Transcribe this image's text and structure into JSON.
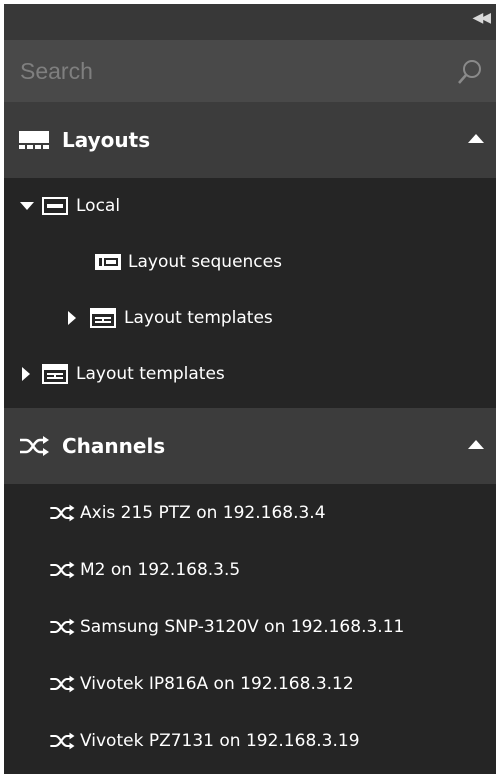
{
  "search": {
    "placeholder": "Search"
  },
  "layouts": {
    "title": "Layouts",
    "tree": {
      "local": "Local",
      "layout_sequences": "Layout sequences",
      "layout_templates_nested": "Layout templates",
      "layout_templates": "Layout templates"
    }
  },
  "channels": {
    "title": "Channels",
    "items": [
      "Axis 215 PTZ on 192.168.3.4",
      "M2 on 192.168.3.5",
      "Samsung SNP-3120V on 192.168.3.11",
      "Vivotek IP816A on 192.168.3.12",
      "Vivotek PZ7131 on 192.168.3.19"
    ]
  },
  "colors": {
    "panel_bg": "#252525",
    "header_bg": "#3c3c3c",
    "search_bg": "#494949",
    "topbar_bg": "#383838",
    "text": "#ffffff"
  }
}
